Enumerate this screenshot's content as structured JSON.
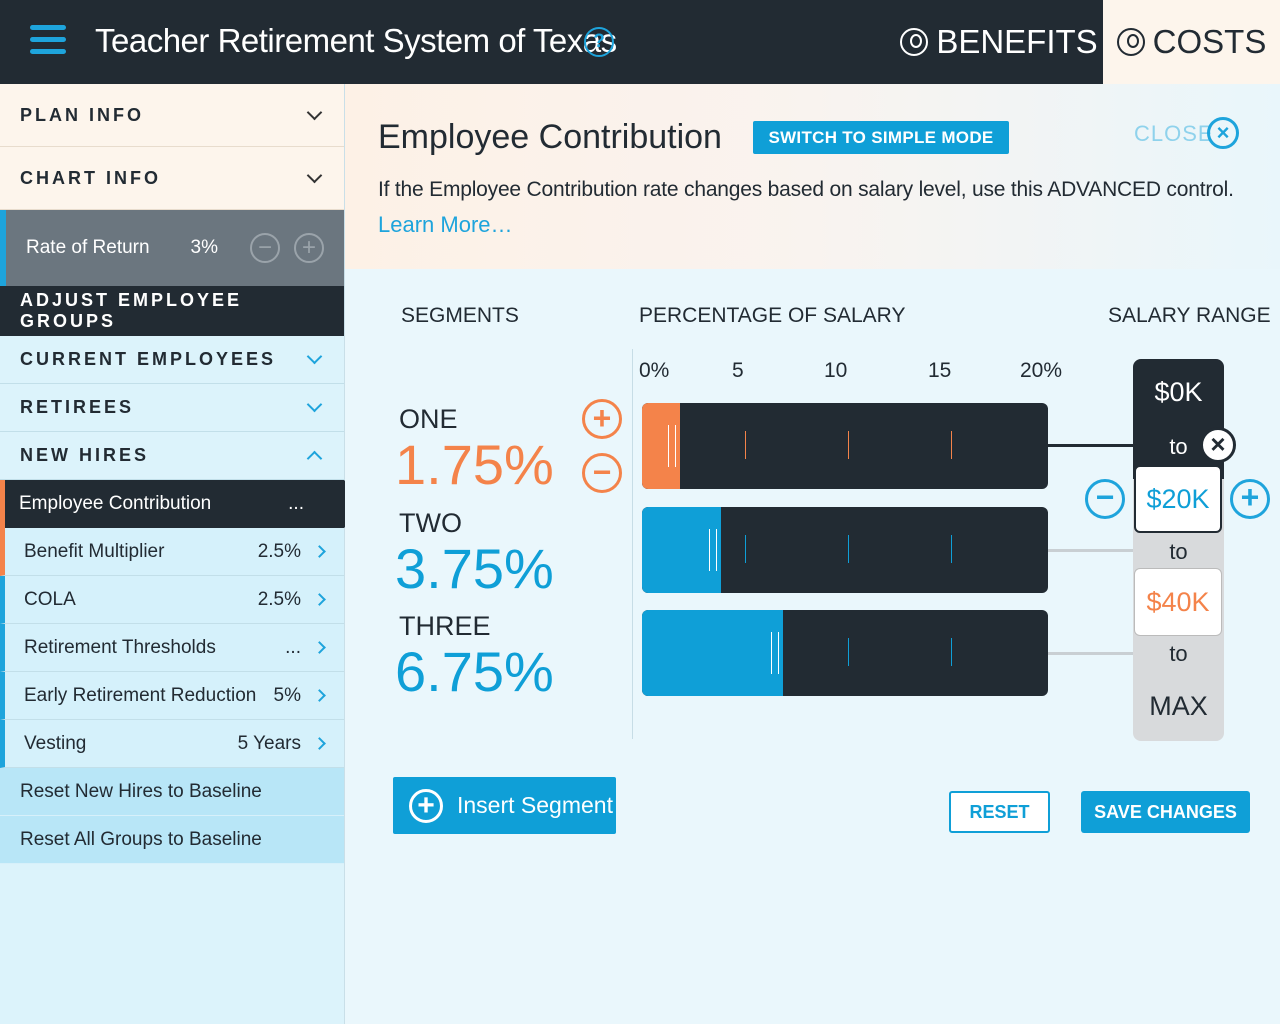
{
  "header": {
    "title": "Teacher Retirement System of Texas",
    "help": "?",
    "tab_benefits": "BENEFITS",
    "tab_costs": "COSTS"
  },
  "sidebar": {
    "plan_info": "PLAN INFO",
    "chart_info": "CHART INFO",
    "rate_of_return": {
      "label": "Rate of Return",
      "value": "3%"
    },
    "adjust_groups": "ADJUST EMPLOYEE GROUPS",
    "groups": [
      "CURRENT EMPLOYEES",
      "RETIREES",
      "NEW HIRES"
    ],
    "active_item": {
      "label": "Employee Contribution",
      "value": "..."
    },
    "items": [
      {
        "label": "Benefit Multiplier",
        "value": "2.5%"
      },
      {
        "label": "COLA",
        "value": "2.5%"
      },
      {
        "label": "Retirement Thresholds",
        "value": "..."
      },
      {
        "label": "Early Retirement Reduction",
        "value": "5%"
      },
      {
        "label": "Vesting",
        "value": "5 Years"
      }
    ],
    "reset_new_hires": "Reset New Hires to Baseline",
    "reset_all": "Reset All Groups to Baseline"
  },
  "panel": {
    "title": "Employee Contribution",
    "simple_mode": "SWITCH TO SIMPLE MODE",
    "close": "CLOSE",
    "description": "If the Employee Contribution rate changes based on salary level, use this ADVANCED control.",
    "learn_more": "Learn More…",
    "col_segments": "SEGMENTS",
    "col_percentage": "PERCENTAGE OF SALARY",
    "col_salary": "SALARY RANGE",
    "scale": [
      "0%",
      "5",
      "10",
      "15",
      "20%"
    ],
    "segments": [
      {
        "name": "ONE",
        "pct": "1.75%",
        "value": 1.75,
        "color": "#f4834a"
      },
      {
        "name": "TWO",
        "pct": "3.75%",
        "value": 3.75,
        "color": "#0f9fd7"
      },
      {
        "name": "THREE",
        "pct": "6.75%",
        "value": 6.75,
        "color": "#0f9fd7"
      }
    ],
    "salary": {
      "start": "$0K",
      "to": "to",
      "b1": "$20K",
      "b2": "$40K",
      "end": "MAX"
    },
    "insert_segment": "Insert Segment",
    "reset": "RESET",
    "save": "SAVE CHANGES"
  },
  "colors": {
    "accent": "#0f9fd7",
    "orange": "#f4834a",
    "dark": "#222b33"
  }
}
